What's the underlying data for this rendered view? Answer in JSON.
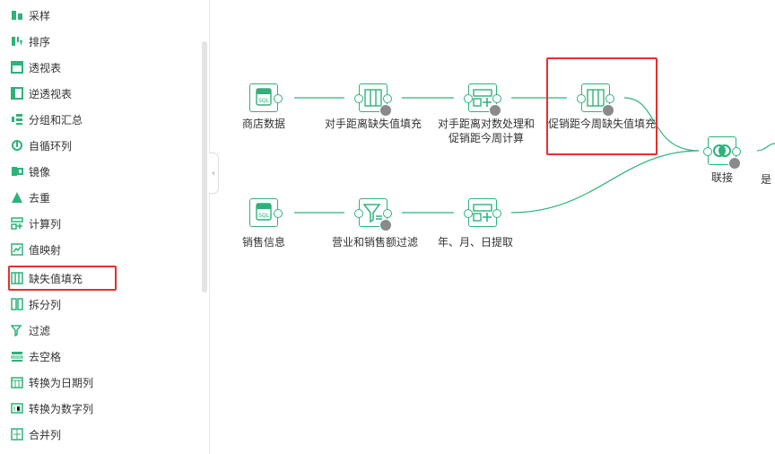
{
  "sidebar": {
    "items": [
      {
        "label": "采样",
        "icon": "sampling-icon"
      },
      {
        "label": "排序",
        "icon": "sort-icon"
      },
      {
        "label": "透视表",
        "icon": "pivot-icon"
      },
      {
        "label": "逆透视表",
        "icon": "unpivot-icon"
      },
      {
        "label": "分组和汇总",
        "icon": "group-summary-icon"
      },
      {
        "label": "自循环列",
        "icon": "self-loop-icon"
      },
      {
        "label": "镜像",
        "icon": "mirror-icon"
      },
      {
        "label": "去重",
        "icon": "dedupe-icon"
      },
      {
        "label": "计算列",
        "icon": "calc-column-icon"
      },
      {
        "label": "值映射",
        "icon": "value-map-icon"
      },
      {
        "label": "缺失值填充",
        "icon": "missing-fill-icon"
      },
      {
        "label": "拆分列",
        "icon": "split-column-icon"
      },
      {
        "label": "过滤",
        "icon": "filter-icon"
      },
      {
        "label": "去空格",
        "icon": "trim-icon"
      },
      {
        "label": "转换为日期列",
        "icon": "to-date-icon"
      },
      {
        "label": "转换为数字列",
        "icon": "to-number-icon"
      },
      {
        "label": "合并列",
        "icon": "merge-column-icon"
      }
    ],
    "selected": "缺失值填充"
  },
  "flow": {
    "nodes": [
      {
        "label": "商店数据",
        "icon": "sql-icon"
      },
      {
        "label": "对手距离缺失值填充",
        "icon": "missing-fill-icon"
      },
      {
        "label": "对手距离对数处理和促销距今周计算",
        "icon": "calc-column-icon"
      },
      {
        "label": "促销距今周缺失值填充",
        "icon": "missing-fill-icon"
      },
      {
        "label": "联接",
        "icon": "join-icon"
      },
      {
        "label": "是",
        "icon": ""
      },
      {
        "label": "销售信息",
        "icon": "sql-icon"
      },
      {
        "label": "营业和销售额过滤",
        "icon": "filter-icon"
      },
      {
        "label": "年、月、日提取",
        "icon": "calc-column-icon"
      }
    ]
  },
  "colors": {
    "accent": "#2db37a",
    "highlight": "#e62f2f"
  }
}
